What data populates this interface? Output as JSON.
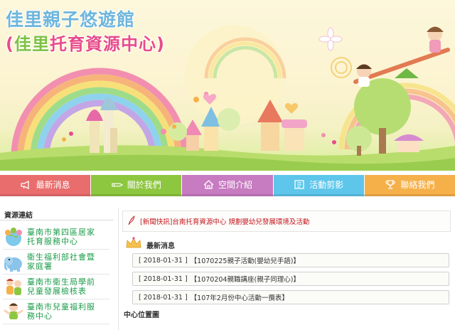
{
  "site": {
    "title": "佳里親子悠遊館",
    "subtitle_open": "(",
    "subtitle_highlight": "佳里",
    "subtitle_rest": "托育資源中心)"
  },
  "nav": {
    "items": [
      {
        "label": "最新消息",
        "icon": "megaphone-icon",
        "color": "#e96d6d"
      },
      {
        "label": "關於我們",
        "icon": "pencil-icon",
        "color": "#8dc63f"
      },
      {
        "label": "空間介紹",
        "icon": "house-icon",
        "color": "#c77bc0"
      },
      {
        "label": "活動剪影",
        "icon": "photo-icon",
        "color": "#5dc6ea"
      },
      {
        "label": "聯絡我們",
        "icon": "trophy-icon",
        "color": "#f6b04a"
      }
    ]
  },
  "sidebar": {
    "title": "資源連結",
    "links": [
      {
        "label_line1": "臺南市第四區居家",
        "label_line2": "托育服務中心",
        "icon": "children-globe-icon"
      },
      {
        "label_line1": "衛生福利部社會暨",
        "label_line2": "家庭署",
        "icon": "elephant-icon"
      },
      {
        "label_line1": "臺南市衛生局學前",
        "label_line2": "兒童發展檢核表",
        "icon": "kids-icon"
      },
      {
        "label_line1": "臺南市兒童福利服",
        "label_line2": "務中心",
        "icon": "children-icon"
      }
    ]
  },
  "main": {
    "flash": "[新聞快訊]台南托育資源中心   規劃嬰幼兒發展環境及活動",
    "news_title": "最新消息",
    "news": [
      {
        "date": "[ 2018-01-31 ]",
        "title": "【1070225親子活動(嬰幼兒手語)】"
      },
      {
        "date": "[ 2018-01-31 ]",
        "title": "【1070204親職講座(親子同理心)】"
      },
      {
        "date": "[ 2018-01-31 ]",
        "title": "【107年2月份中心活動一攬表】"
      }
    ],
    "location_title": "中心位置圖"
  }
}
